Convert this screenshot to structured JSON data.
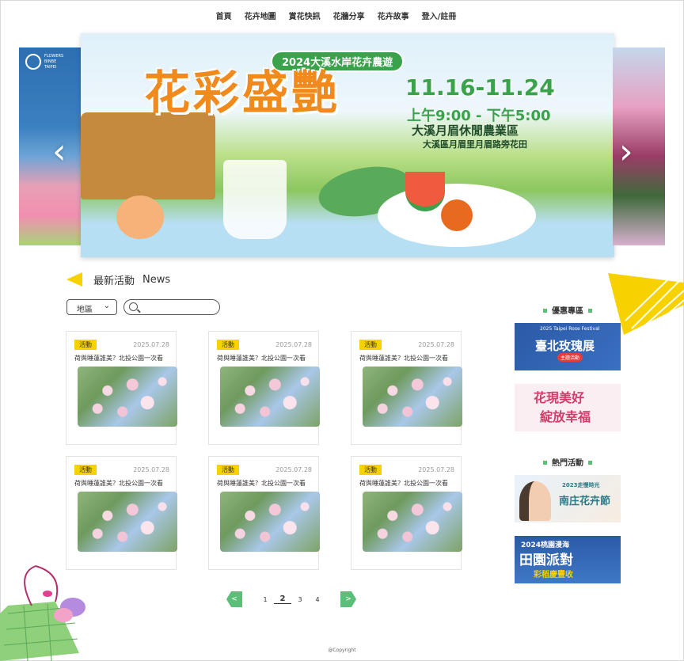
{
  "nav": {
    "items": [
      "首頁",
      "花卉地圖",
      "賞花快訊",
      "花牆分享",
      "花卉故事",
      "登入/註冊"
    ]
  },
  "carousel": {
    "left_logo_text": [
      "FLOWERS",
      "BINBE",
      "TAIPEI"
    ],
    "banner_subtitle": "2024大溪水岸花卉農遊",
    "banner_title": "花彩盛艷",
    "banner_dates": "11.16-11.24",
    "banner_time": "上午9:00 - 下午5:00",
    "banner_place": "大溪月眉休閒農業區",
    "banner_address": "大溪區月眉里月眉路旁花田",
    "prev_icon": "chevron-left-icon",
    "next_icon": "chevron-right-icon"
  },
  "news": {
    "title": "最新活動",
    "title_en": "News",
    "region_label": "地區",
    "search_placeholder": ""
  },
  "cards": [
    {
      "tag": "活動",
      "date": "2025.07.28",
      "title": "荷與睡蓮誰美？北投公園一次看"
    },
    {
      "tag": "活動",
      "date": "2025.07.28",
      "title": "荷與睡蓮誰美？北投公園一次看"
    },
    {
      "tag": "活動",
      "date": "2025.07.28",
      "title": "荷與睡蓮誰美？北投公園一次看"
    },
    {
      "tag": "活動",
      "date": "2025.07.28",
      "title": "荷與睡蓮誰美？北投公園一次看"
    },
    {
      "tag": "活動",
      "date": "2025.07.28",
      "title": "荷與睡蓮誰美？北投公園一次看"
    },
    {
      "tag": "活動",
      "date": "2025.07.28",
      "title": "荷與睡蓮誰美？北投公園一次看"
    }
  ],
  "sidebar": {
    "promo_heading": "優惠專區",
    "hot_heading": "熱門活動",
    "promo1": {
      "sub": "2025 Taipei Rose Festival",
      "main": "臺北玫瑰展",
      "tag": "主題活動"
    },
    "promo2": {
      "a": "花現美好",
      "b": "綻放幸福"
    },
    "promo3": {
      "a": "南庄花卉節",
      "b": "2023走慢時光"
    },
    "promo4": {
      "a": "2024桃園漫海",
      "b": "田園派對",
      "c": "彩稻慶豐收"
    }
  },
  "pager": {
    "pages": [
      "1",
      "2",
      "3",
      "4"
    ],
    "active": "2",
    "prev": "<",
    "next": ">"
  },
  "footer": {
    "copyright": "@Copyright"
  },
  "colors": {
    "accent_yellow": "#f7d100",
    "accent_green": "#5bbf7a",
    "banner_orange": "#f08a1c"
  }
}
